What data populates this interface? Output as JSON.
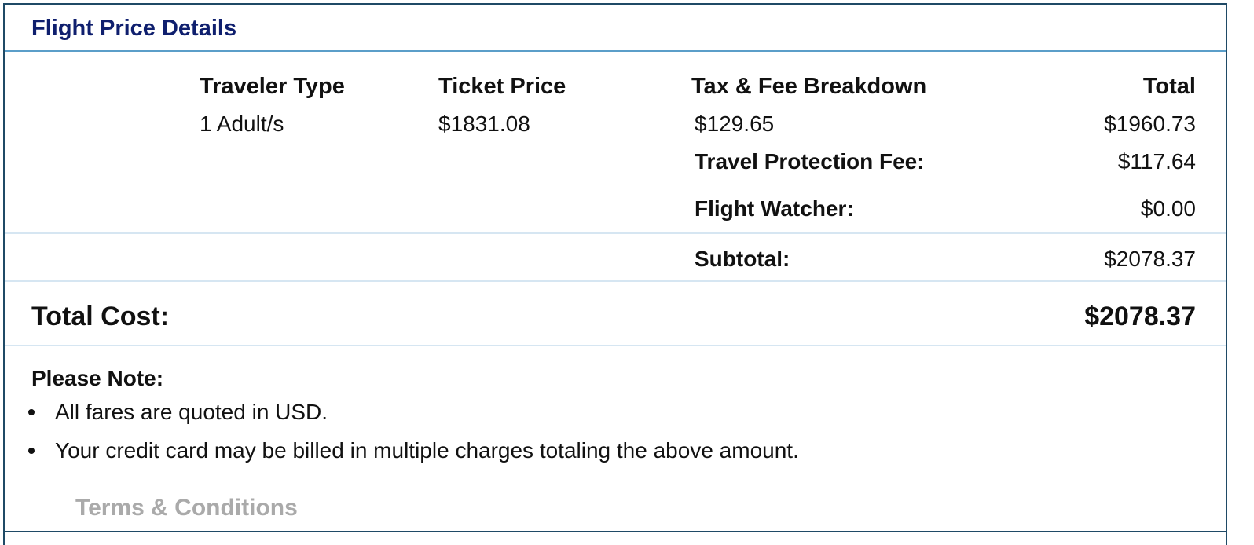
{
  "header": {
    "title": "Flight Price Details"
  },
  "columns": {
    "traveler_type": "Traveler Type",
    "ticket_price": "Ticket Price",
    "tax_fee": "Tax & Fee Breakdown",
    "total": "Total"
  },
  "row": {
    "traveler_type": "1 Adult/s",
    "ticket_price": "$1831.08",
    "tax_fee": "$129.65",
    "total": "$1960.73"
  },
  "fees": {
    "travel_protection_label": "Travel Protection Fee:",
    "travel_protection_value": "$117.64",
    "flight_watcher_label": "Flight Watcher:",
    "flight_watcher_value": "$0.00",
    "subtotal_label": "Subtotal:",
    "subtotal_value": "$2078.37"
  },
  "total_cost": {
    "label": "Total Cost:",
    "value": "$2078.37"
  },
  "note": {
    "title": "Please Note:",
    "items": [
      "All fares are quoted in USD.",
      "Your credit card may be billed in multiple charges totaling the above amount."
    ]
  },
  "terms_link": "Terms & Conditions",
  "colors": {
    "border": "#1f4a66",
    "header_title": "#0f1f6e",
    "header_rule": "#5b9ec9",
    "divider": "#d6e6f2",
    "link_muted": "#aaaaaa"
  }
}
